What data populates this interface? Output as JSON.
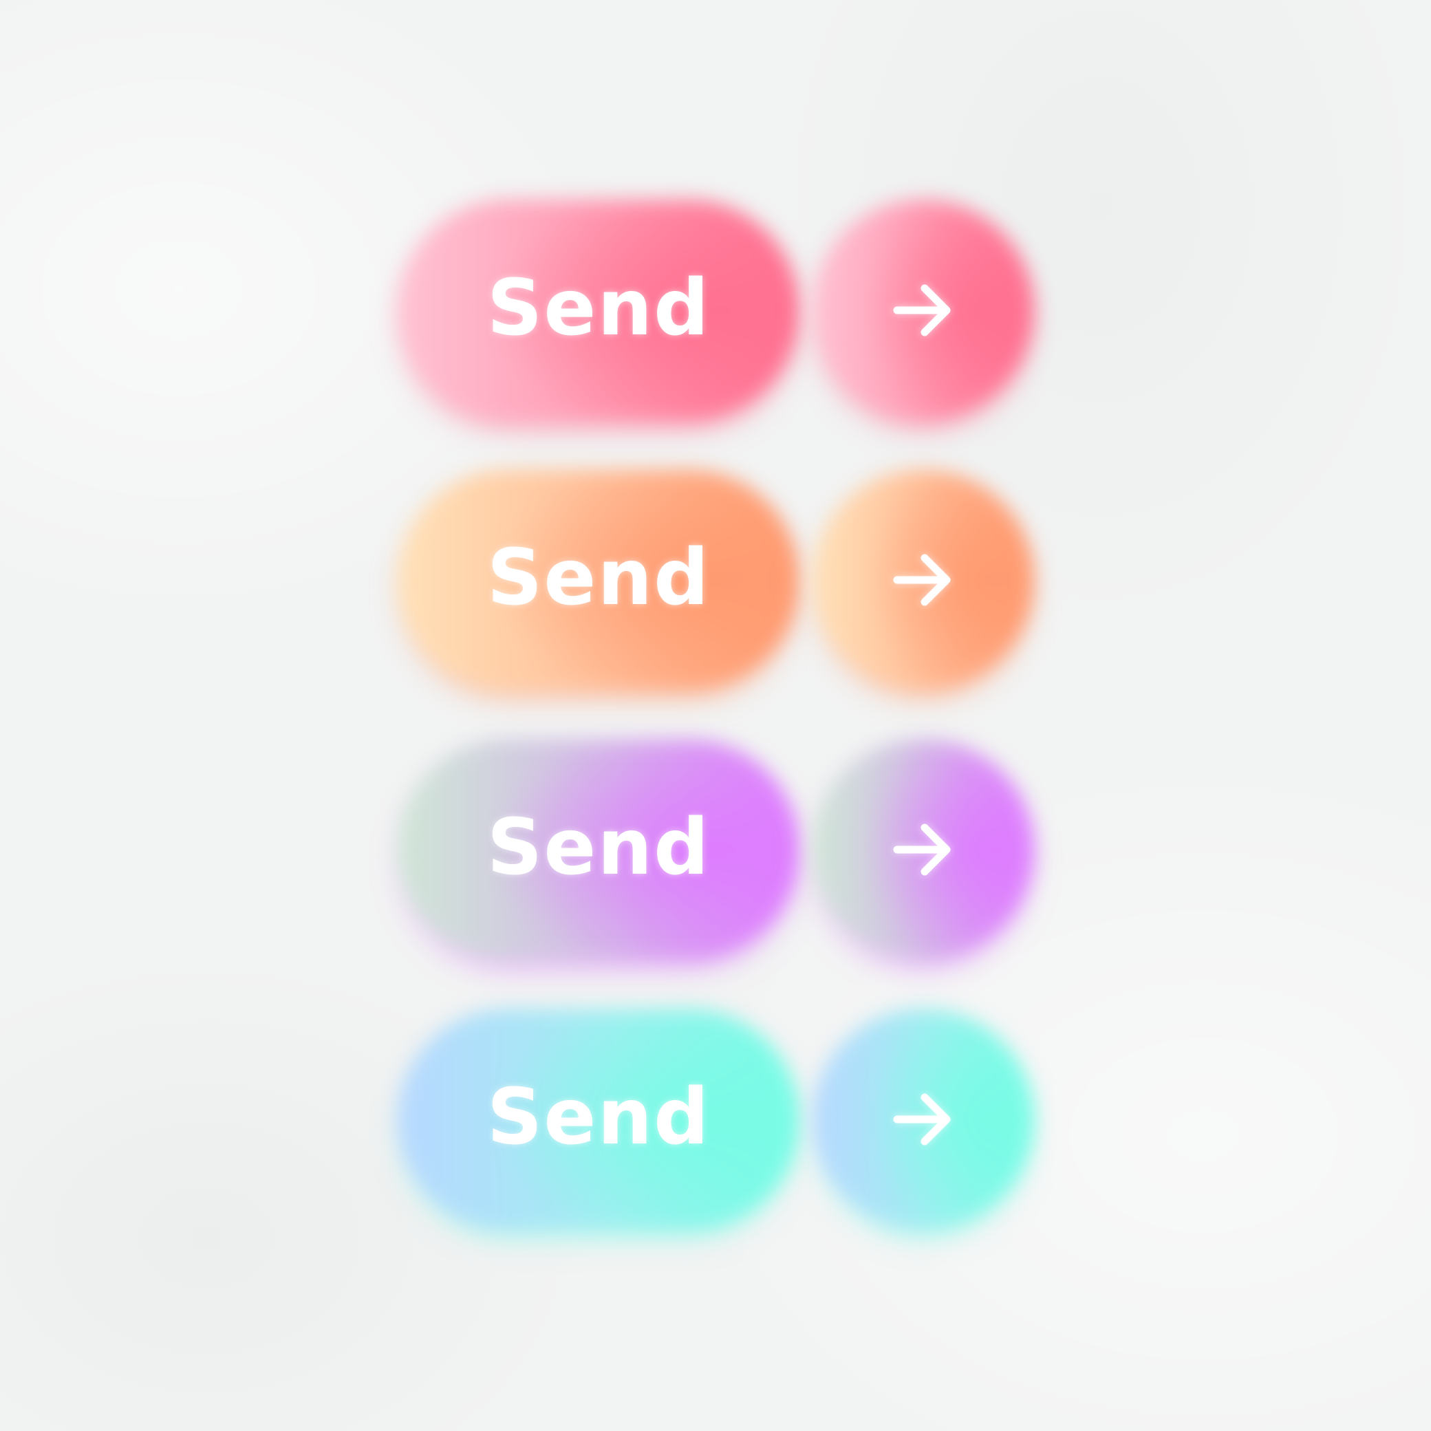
{
  "buttons": [
    {
      "label": "Send",
      "icon": "arrow-right-icon",
      "colors": [
        "#ffc2d3",
        "#ff97b0",
        "#ff7090"
      ]
    },
    {
      "label": "Send",
      "icon": "arrow-right-icon",
      "colors": [
        "#ffe1b8",
        "#ffbc96",
        "#ff9a70"
      ]
    },
    {
      "label": "Send",
      "icon": "arrow-right-icon",
      "colors": [
        "#cfe6d6",
        "#d3b7e7",
        "#de7cff"
      ]
    },
    {
      "label": "Send",
      "icon": "arrow-right-icon",
      "colors": [
        "#b7d8ff",
        "#a0eef0",
        "#78fce6"
      ]
    }
  ]
}
